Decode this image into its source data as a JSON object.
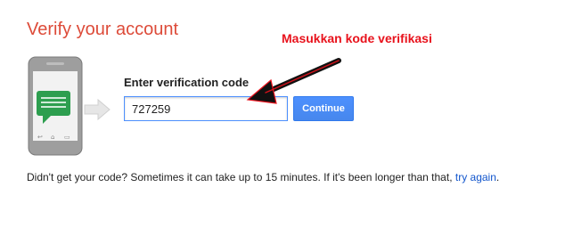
{
  "page": {
    "title": "Verify your account"
  },
  "annotation": {
    "text": "Masukkan kode verifikasi"
  },
  "form": {
    "label": "Enter verification code",
    "code_value": "727259",
    "continue_label": "Continue"
  },
  "footer": {
    "text": "Didn't get your code? Sometimes it can take up to 15 minutes. If it's been longer than that, ",
    "link": "try again",
    "end": "."
  },
  "colors": {
    "title": "#dd4b39",
    "annotation": "#e8121c",
    "button": "#4d90fe",
    "link": "#1155cc",
    "phone_body": "#9e9e9e",
    "message_bubble": "#2d9e4f"
  },
  "icons": [
    "phone-illustration",
    "message-icon",
    "gray-arrow-icon",
    "annotation-arrow"
  ]
}
